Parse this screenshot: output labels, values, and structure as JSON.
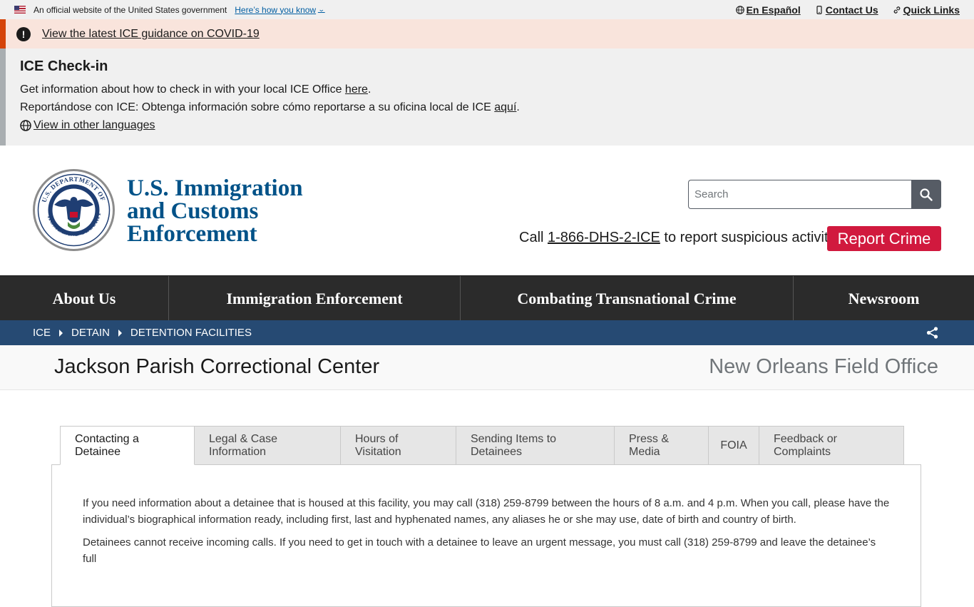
{
  "gov_banner": {
    "text": "An official website of the United States government",
    "howknow": "Here’s how you know",
    "links": [
      {
        "label": "En Español",
        "icon": "globe-icon"
      },
      {
        "label": "Contact Us",
        "icon": "phone-icon"
      },
      {
        "label": "Quick Links",
        "icon": "link-icon"
      }
    ]
  },
  "alert": {
    "icon": "!",
    "link": "View the latest ICE guidance on COVID-19"
  },
  "checkin": {
    "title": "ICE Check-in",
    "line1_text": "Get information about how to check in with your local ICE Office ",
    "line1_link": "here",
    "line1_end": ".",
    "line2_text": "Reportándose con ICE: Obtenga información sobre cómo reportarse a su oficina local de ICE ",
    "line2_link": "aquí",
    "line2_end": ".",
    "languages_link": "View in other languages"
  },
  "header": {
    "agency_line1": "U.S. Immigration",
    "agency_line2": "and Customs",
    "agency_line3": "Enforcement",
    "seal_text": "U.S. DEPARTMENT OF HOMELAND SECURITY",
    "search_placeholder": "Search",
    "call_prefix": "Call ",
    "call_number": "1-866-DHS-2-ICE",
    "call_suffix": " to report suspicious activity",
    "report_button": "Report Crime"
  },
  "nav": {
    "items": [
      {
        "label": "About Us"
      },
      {
        "label": "Immigration Enforcement"
      },
      {
        "label": "Combating Transnational Crime"
      },
      {
        "label": "Newsroom"
      }
    ]
  },
  "breadcrumb": {
    "items": [
      "ICE",
      "DETAIN",
      "DETENTION FACILITIES"
    ]
  },
  "page": {
    "title": "Jackson Parish Correctional Center",
    "field_office": "New Orleans Field Office"
  },
  "tabs": [
    {
      "label": "Contacting a Detainee",
      "active": true
    },
    {
      "label": "Legal & Case Information",
      "active": false
    },
    {
      "label": "Hours of Visitation",
      "active": false
    },
    {
      "label": "Sending Items to Detainees",
      "active": false
    },
    {
      "label": "Press & Media",
      "active": false
    },
    {
      "label": "FOIA",
      "active": false
    },
    {
      "label": "Feedback or Complaints",
      "active": false
    }
  ],
  "panel": {
    "p1": "If you need information about a detainee that is housed at this facility, you may call (318) 259-8799 between the hours of 8 a.m. and 4 p.m. When you call, please have the individual’s biographical information ready, including first, last and hyphenated names, any aliases he or she may use, date of birth and country of birth.",
    "p2": "Detainees cannot receive incoming calls. If you need to get in touch with a detainee to leave an urgent message, you must call (318) 259-8799 and leave the detainee’s full"
  },
  "colors": {
    "alert_bg": "#f9e4dc",
    "alert_border": "#d54309",
    "agency_blue": "#005288",
    "nav_bg": "#2b2b2b",
    "breadcrumb_bg": "#264a73",
    "report_red": "#d1193e"
  }
}
